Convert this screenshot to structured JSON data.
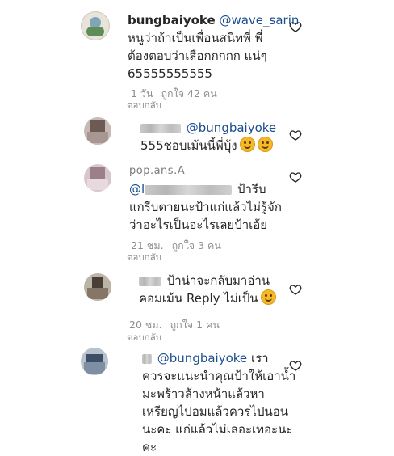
{
  "comments": [
    {
      "username": "bungbaiyoke",
      "mention": "@wave_sarin",
      "text_l1": "หนูว่าถ้าเป็นเพื่อนสนิทพี่ พี่",
      "text_l2": "ต้องตอบว่าเสือกกกกก แน่ๆ",
      "text_l3": "65555555555",
      "time": "1 วัน",
      "likes": "ถูกใจ 42 คน",
      "reply_label": "ตอบกลับ"
    },
    {
      "mention": "@bungbaiyoke",
      "text_l1": "555ชอบเม้นนี้พี่บุ้ง",
      "reply_label": ""
    },
    {
      "username_partial": "pop.ans.A",
      "mention_partial": "@l",
      "text_l1_tail": "ป้ารีบ",
      "text_l2": "แกรีบตายนะป้าแก่แล้วไม่รู้จัก",
      "text_l3": "ว่าอะไรเป็นอะไรเลยป้าเอ้ย",
      "time": "21 ชม.",
      "likes": "ถูกใจ 3 คน",
      "reply_label": "ตอบกลับ"
    },
    {
      "text_l1_tail": "ป้าน่าจะกลับมาอ่าน",
      "text_l2": "คอมเม้น Reply ไม่เป็น",
      "time": "20 ชม.",
      "likes": "ถูกใจ 1 คน",
      "reply_label": "ตอบกลับ"
    },
    {
      "mention": "@bungbaiyoke",
      "text_l1_tail": "เรา",
      "text_l2": "ควรจะแนะนำคุณป้าให้เอาน้ำ",
      "text_l3": "มะพร้าวล้างหน้าแล้วหา",
      "text_l4": "เหรียญไปอมแล้วควรไปนอน",
      "text_l5": "นะคะ แก่แล้วไม่เลอะเทอะนะ",
      "text_l6": "คะ"
    }
  ],
  "icons": {
    "like": "heart-outline-icon",
    "emoji": "grinning-face-emoji"
  },
  "colors": {
    "text": "#262626",
    "meta": "#8e8e8e",
    "mention": "#1a4d8c",
    "heart": "#262626"
  }
}
